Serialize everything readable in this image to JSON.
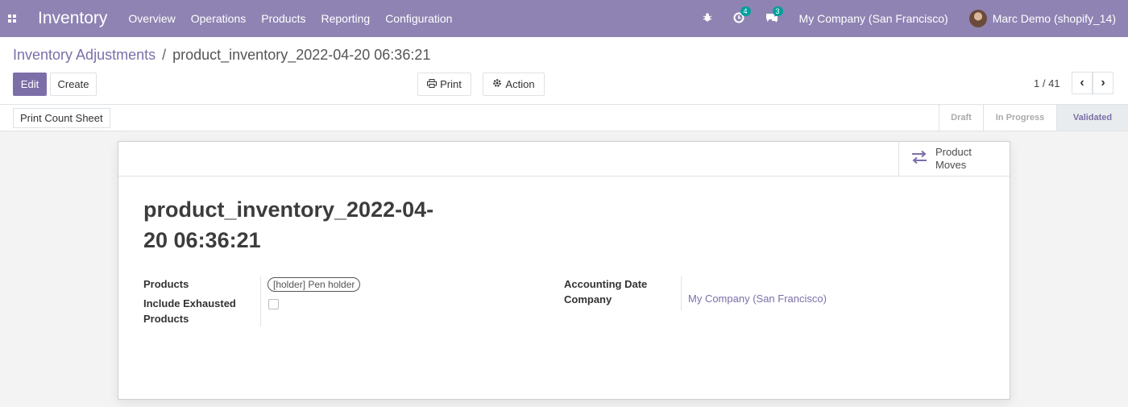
{
  "navbar": {
    "app_name": "Inventory",
    "menu": [
      "Overview",
      "Operations",
      "Products",
      "Reporting",
      "Configuration"
    ],
    "activity_count": "4",
    "messages_count": "3",
    "company": "My Company (San Francisco)",
    "user": "Marc Demo (shopify_14)",
    "bg_color": "#8f83b3"
  },
  "breadcrumb": {
    "parent": "Inventory Adjustments",
    "separator": "/",
    "current": "product_inventory_2022-04-20 06:36:21"
  },
  "buttons": {
    "edit": "Edit",
    "create": "Create",
    "print": "Print",
    "action": "Action",
    "print_count_sheet": "Print Count Sheet"
  },
  "pager": {
    "value": "1 / 41"
  },
  "stages": [
    "Draft",
    "In Progress",
    "Validated"
  ],
  "active_stage": "Validated",
  "smart_button": {
    "label_line1": "Product",
    "label_line2": "Moves"
  },
  "record": {
    "title_line1": "product_inventory_2022-04-",
    "title_line2": "20 06:36:21",
    "products_label": "Products",
    "products_tag": "[holder] Pen holder",
    "include_exhausted_label_line1": "Include Exhausted",
    "include_exhausted_label_line2": "Products",
    "include_exhausted_checked": false,
    "accounting_date_label": "Accounting Date",
    "company_label": "Company",
    "company_value": "My Company (San Francisco)"
  },
  "accent_color": "#7c6fa8"
}
